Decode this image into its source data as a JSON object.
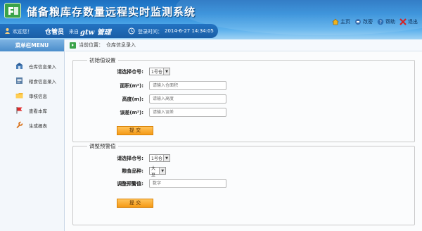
{
  "app": {
    "title": "储备粮库存数量远程实时监测系统"
  },
  "userbar": {
    "welcome": "欢迎您！",
    "role": "仓管员",
    "from_label": "来自",
    "username": "gtw 管理",
    "login_time_label": "登录时间：",
    "login_time": "2014-6-27  14:34:05"
  },
  "topnav": [
    {
      "label": "主页",
      "icon": "home-icon"
    },
    {
      "label": "改密",
      "icon": "password-icon"
    },
    {
      "label": "帮助",
      "icon": "help-icon"
    },
    {
      "label": "退出",
      "icon": "exit-icon"
    }
  ],
  "sidebar": {
    "header": "菜单栏MENU",
    "items": [
      {
        "label": "仓库信息录入",
        "icon": "warehouse-icon"
      },
      {
        "label": "粮食信息录入",
        "icon": "grain-data-icon"
      },
      {
        "label": "审核信息",
        "icon": "folder-icon"
      },
      {
        "label": "查看本库",
        "icon": "flag-icon"
      },
      {
        "label": "生成报表",
        "icon": "wrench-icon"
      }
    ]
  },
  "breadcrumb": {
    "label": "当前位置：",
    "current": "仓库信息录入"
  },
  "initial_settings": {
    "legend": "初始值设置",
    "fields": [
      {
        "label": "请选择仓号:",
        "type": "select",
        "value": "1号仓"
      },
      {
        "label": "面积(m²):",
        "type": "text",
        "placeholder": "请输入仓面积"
      },
      {
        "label": "高度(m):",
        "type": "text",
        "placeholder": "请输入高度"
      },
      {
        "label": "误差(m³):",
        "type": "text",
        "placeholder": "请输入误差"
      }
    ],
    "submit": "提 交"
  },
  "alarm_settings": {
    "legend": "调整预警值",
    "fields": [
      {
        "label": "请选择仓号:",
        "type": "select",
        "value": "1号仓"
      },
      {
        "label": "粮食品种:",
        "type": "select",
        "value": "大豆"
      },
      {
        "label": "调整预警值:",
        "type": "text",
        "placeholder": "数字"
      }
    ],
    "submit": "提 交"
  },
  "colors": {
    "header_blue": "#1d6fc0",
    "logo_green": "#3aa34a",
    "submit_orange": "#f59a17"
  }
}
